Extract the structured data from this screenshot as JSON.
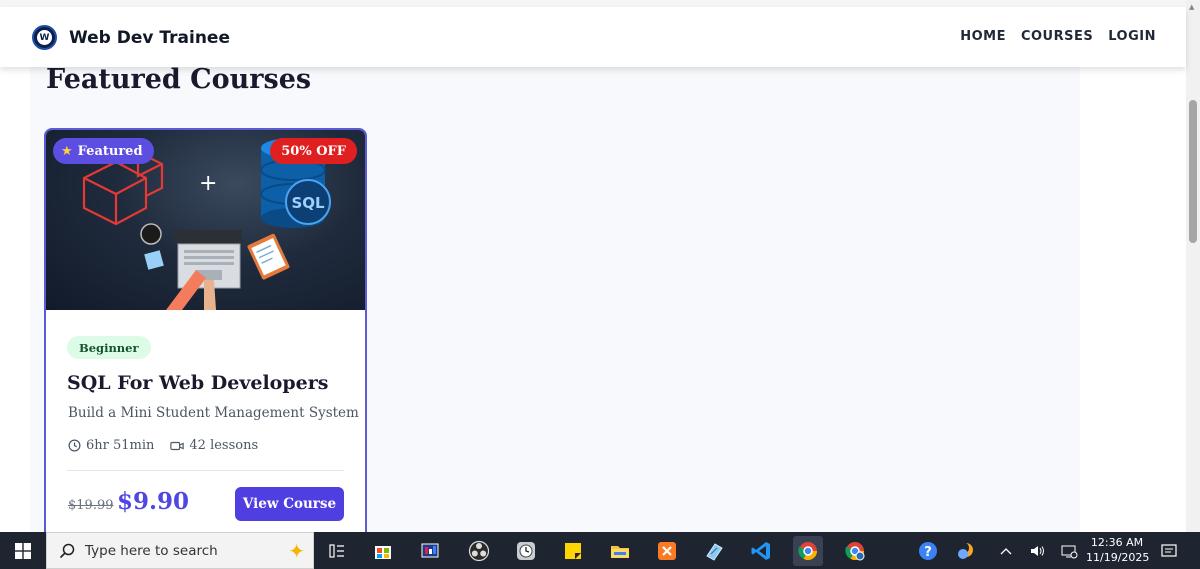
{
  "header": {
    "logo_text": "W",
    "brand": "Web Dev Trainee",
    "nav": [
      "HOME",
      "COURSES",
      "LOGIN"
    ]
  },
  "section": {
    "title": "Featured Courses"
  },
  "course": {
    "badge_featured": "Featured",
    "badge_discount": "50% OFF",
    "thumb_label": "SQL",
    "level": "Beginner",
    "title": "SQL For Web Developers",
    "subtitle": "Build a Mini Student Management System",
    "duration": "6hr 51min",
    "lessons": "42 lessons",
    "old_price": "$19.99",
    "price": "$9.90",
    "cta": "View Course"
  },
  "taskbar": {
    "search_placeholder": "Type here to search",
    "time": "12:36 AM",
    "date": "11/19/2025",
    "apps": [
      "task-view",
      "microsoft-store",
      "media-app",
      "obs-studio",
      "clock-app",
      "sticky-notes",
      "file-explorer",
      "xampp",
      "notepad",
      "vscode",
      "chrome",
      "chrome-profile"
    ]
  },
  "colors": {
    "accent": "#4f46e5",
    "discount": "#e02020",
    "level_bg": "#dcfce7"
  }
}
